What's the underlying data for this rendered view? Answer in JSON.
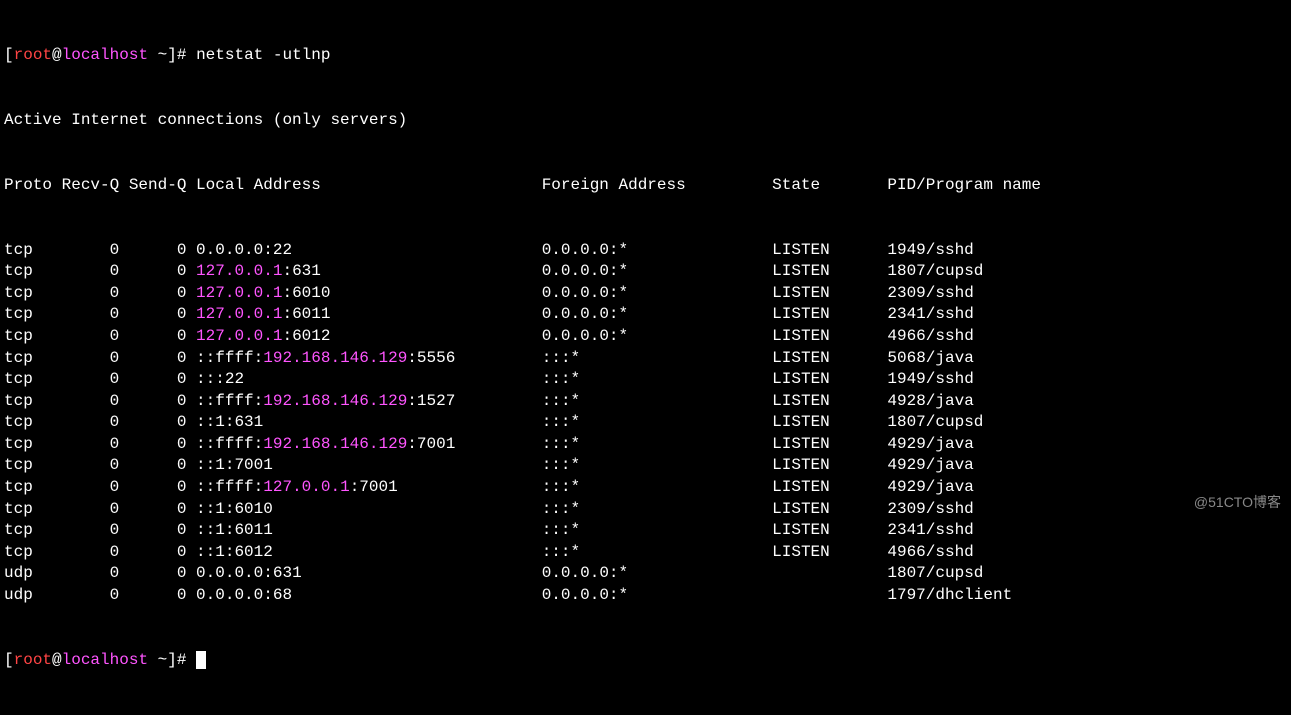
{
  "prompt": {
    "open": "[",
    "user": "root",
    "at": "@",
    "host": "localhost",
    "rest": " ~]# ",
    "close_rest": " ~]# "
  },
  "command": "netstat -utlnp",
  "header_line": "Active Internet connections (only servers)",
  "columns": {
    "proto": "Proto",
    "recvq": "Recv-Q",
    "sendq": "Send-Q",
    "local": "Local Address",
    "foreign": "Foreign Address",
    "state": "State",
    "pid": "PID/Program name"
  },
  "rows": [
    {
      "proto": "tcp",
      "recvq": "0",
      "sendq": "0",
      "local_parts": [
        "0.0.0.0:22"
      ],
      "foreign": "0.0.0.0:*",
      "state": "LISTEN",
      "pid": "1949/sshd"
    },
    {
      "proto": "tcp",
      "recvq": "0",
      "sendq": "0",
      "local_parts": [
        {
          "t": "127.0.0.1",
          "c": "ip"
        },
        ":631"
      ],
      "foreign": "0.0.0.0:*",
      "state": "LISTEN",
      "pid": "1807/cupsd"
    },
    {
      "proto": "tcp",
      "recvq": "0",
      "sendq": "0",
      "local_parts": [
        {
          "t": "127.0.0.1",
          "c": "ip"
        },
        ":6010"
      ],
      "foreign": "0.0.0.0:*",
      "state": "LISTEN",
      "pid": "2309/sshd"
    },
    {
      "proto": "tcp",
      "recvq": "0",
      "sendq": "0",
      "local_parts": [
        {
          "t": "127.0.0.1",
          "c": "ip"
        },
        ":6011"
      ],
      "foreign": "0.0.0.0:*",
      "state": "LISTEN",
      "pid": "2341/sshd"
    },
    {
      "proto": "tcp",
      "recvq": "0",
      "sendq": "0",
      "local_parts": [
        {
          "t": "127.0.0.1",
          "c": "ip"
        },
        ":6012"
      ],
      "foreign": "0.0.0.0:*",
      "state": "LISTEN",
      "pid": "4966/sshd"
    },
    {
      "proto": "tcp",
      "recvq": "0",
      "sendq": "0",
      "local_parts": [
        "::ffff:",
        {
          "t": "192.168.146.129",
          "c": "ip"
        },
        ":5556"
      ],
      "foreign": ":::*",
      "state": "LISTEN",
      "pid": "5068/java"
    },
    {
      "proto": "tcp",
      "recvq": "0",
      "sendq": "0",
      "local_parts": [
        ":::22"
      ],
      "foreign": ":::*",
      "state": "LISTEN",
      "pid": "1949/sshd"
    },
    {
      "proto": "tcp",
      "recvq": "0",
      "sendq": "0",
      "local_parts": [
        "::ffff:",
        {
          "t": "192.168.146.129",
          "c": "ip"
        },
        ":1527"
      ],
      "foreign": ":::*",
      "state": "LISTEN",
      "pid": "4928/java"
    },
    {
      "proto": "tcp",
      "recvq": "0",
      "sendq": "0",
      "local_parts": [
        "::1:631"
      ],
      "foreign": ":::*",
      "state": "LISTEN",
      "pid": "1807/cupsd"
    },
    {
      "proto": "tcp",
      "recvq": "0",
      "sendq": "0",
      "local_parts": [
        "::ffff:",
        {
          "t": "192.168.146.129",
          "c": "ip"
        },
        ":7001"
      ],
      "foreign": ":::*",
      "state": "LISTEN",
      "pid": "4929/java"
    },
    {
      "proto": "tcp",
      "recvq": "0",
      "sendq": "0",
      "local_parts": [
        "::1:7001"
      ],
      "foreign": ":::*",
      "state": "LISTEN",
      "pid": "4929/java"
    },
    {
      "proto": "tcp",
      "recvq": "0",
      "sendq": "0",
      "local_parts": [
        "::ffff:",
        {
          "t": "127.0.0.1",
          "c": "ip"
        },
        ":7001"
      ],
      "foreign": ":::*",
      "state": "LISTEN",
      "pid": "4929/java"
    },
    {
      "proto": "tcp",
      "recvq": "0",
      "sendq": "0",
      "local_parts": [
        "::1:6010"
      ],
      "foreign": ":::*",
      "state": "LISTEN",
      "pid": "2309/sshd"
    },
    {
      "proto": "tcp",
      "recvq": "0",
      "sendq": "0",
      "local_parts": [
        "::1:6011"
      ],
      "foreign": ":::*",
      "state": "LISTEN",
      "pid": "2341/sshd"
    },
    {
      "proto": "tcp",
      "recvq": "0",
      "sendq": "0",
      "local_parts": [
        "::1:6012"
      ],
      "foreign": ":::*",
      "state": "LISTEN",
      "pid": "4966/sshd"
    },
    {
      "proto": "udp",
      "recvq": "0",
      "sendq": "0",
      "local_parts": [
        "0.0.0.0:631"
      ],
      "foreign": "0.0.0.0:*",
      "state": "",
      "pid": "1807/cupsd"
    },
    {
      "proto": "udp",
      "recvq": "0",
      "sendq": "0",
      "local_parts": [
        "0.0.0.0:68"
      ],
      "foreign": "0.0.0.0:*",
      "state": "",
      "pid": "1797/dhclient"
    }
  ],
  "col_widths": {
    "proto": 6,
    "recvq": 7,
    "sendq": 7,
    "local": 36,
    "foreign": 24,
    "state": 12,
    "pid": 24
  },
  "watermark": "@51CTO博客"
}
